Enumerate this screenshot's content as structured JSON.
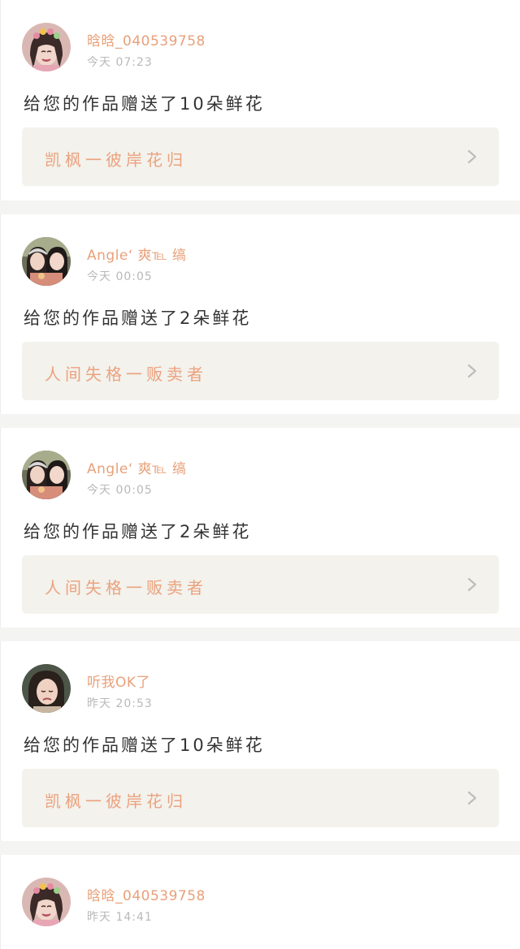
{
  "notifications": [
    {
      "username": "晗晗_040539758",
      "time": "今天 07:23",
      "message": "给您的作品赠送了10朵鲜花",
      "work_title": "凯枫一彼岸花归",
      "avatar": "girl-flower-crown"
    },
    {
      "username": "Angle‘ 爽℡ 缟",
      "time": "今天 00:05",
      "message": "给您的作品赠送了2朵鲜花",
      "work_title": "人间失格一贩卖者",
      "avatar": "two-girls"
    },
    {
      "username": "Angle‘ 爽℡ 缟",
      "time": "今天 00:05",
      "message": "给您的作品赠送了2朵鲜花",
      "work_title": "人间失格一贩卖者",
      "avatar": "two-girls"
    },
    {
      "username": "听我OK了",
      "time": "昨天 20:53",
      "message": "给您的作品赠送了10朵鲜花",
      "work_title": "凯枫一彼岸花归",
      "avatar": "crying-girl"
    },
    {
      "username": "晗晗_040539758",
      "time": "昨天 14:41",
      "avatar": "girl-flower-crown"
    }
  ],
  "colors": {
    "accent": "#e8a07a",
    "link_bg": "#f3f2ec",
    "page_bg": "#f4f4f2"
  },
  "icons": {
    "chevron": "chevron-right-icon"
  }
}
